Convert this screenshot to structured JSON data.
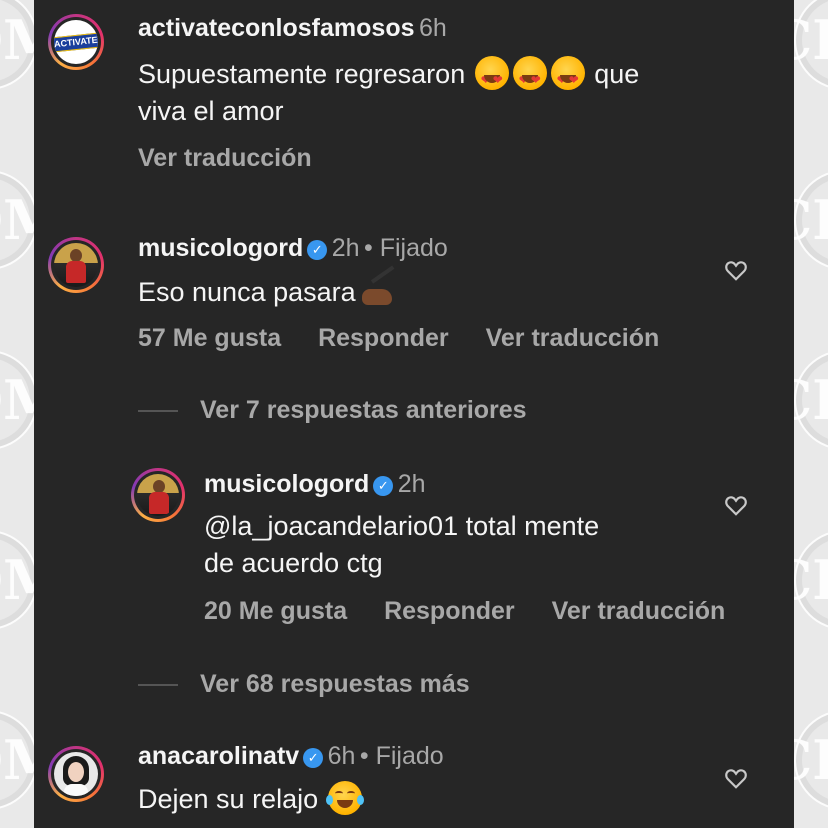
{
  "comments": [
    {
      "username": "activateconlosfamosos",
      "time": "6h",
      "text": "Supuestamente regresaron",
      "text_after_emoji": "que",
      "text_line2": "viva el amor",
      "translate": "Ver traducción",
      "avatar_logo": "ACTIVATE"
    },
    {
      "username": "musicologord",
      "time": "2h",
      "pinned": "• Fijado",
      "text": "Eso nunca pasara",
      "likes": "57 Me gusta",
      "reply": "Responder",
      "translate": "Ver traducción"
    },
    {
      "username": "musicologord",
      "time": "2h",
      "text": "@la_joacandelario01 total mente",
      "text_line2": "de acuerdo ctg",
      "likes": "20 Me gusta",
      "reply": "Responder",
      "translate": "Ver traducción"
    },
    {
      "username": "anacarolinatv",
      "time": "6h",
      "pinned": "• Fijado",
      "text": "Dejen su relajo"
    }
  ],
  "view_previous_replies": "Ver 7 respuestas anteriores",
  "view_more_replies": "Ver 68 respuestas más",
  "watermark": "CDM",
  "icons": [
    "verified-badge-icon",
    "heart-icon",
    "heart-eyes-emoji",
    "writing-hand-emoji",
    "laughing-emoji"
  ],
  "colors": {
    "background": "#262626",
    "text": "#f5f5f5",
    "secondary": "#a8a8a8",
    "verified": "#3897f0"
  }
}
